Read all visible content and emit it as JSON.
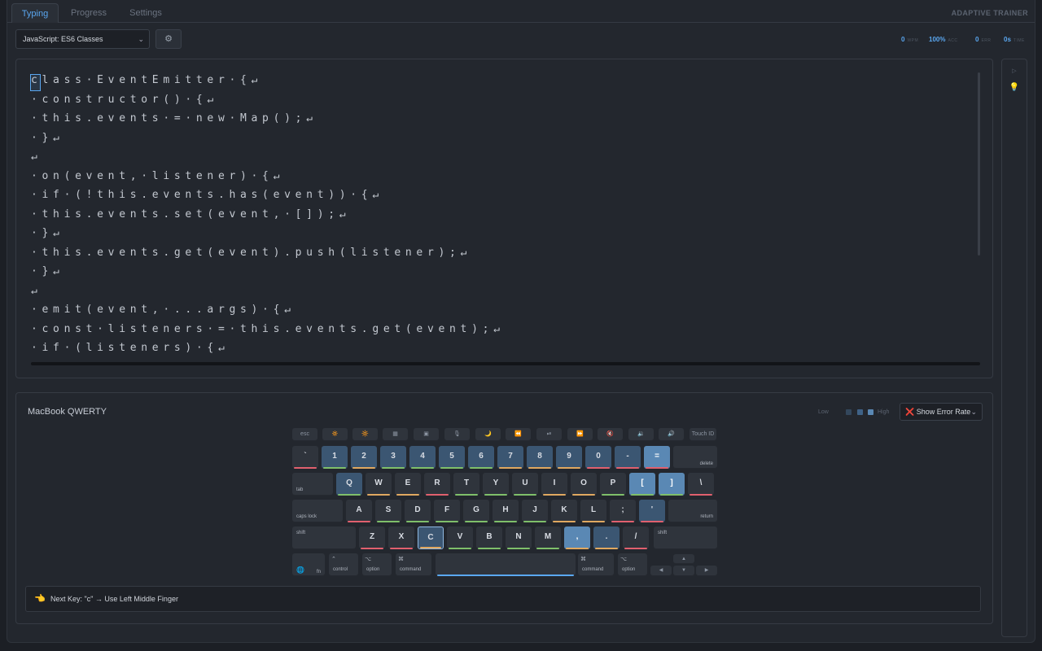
{
  "tabs": [
    {
      "label": "Typing",
      "active": true
    },
    {
      "label": "Progress",
      "active": false
    },
    {
      "label": "Settings",
      "active": false
    }
  ],
  "brand": "ADAPTIVE TRAINER",
  "lesson_select": {
    "value": "JavaScript: ES6 Classes"
  },
  "stats": [
    {
      "value": "0",
      "label": "WPM"
    },
    {
      "value": "100%",
      "label": "ACC"
    },
    {
      "value": "0",
      "label": "ERR"
    },
    {
      "value": "0s",
      "label": "TIME"
    }
  ],
  "code_lines": [
    "class·EventEmitter·{↵",
    "·constructor()·{↵",
    "·this.events·=·new·Map();↵",
    "·}↵",
    "↵",
    "·on(event,·listener)·{↵",
    "·if·(!this.events.has(event))·{↵",
    "·this.events.set(event,·[]);↵",
    "·}↵",
    "·this.events.get(event).push(listener);↵",
    "·}↵",
    "↵",
    "·emit(event,·...args)·{↵",
    "·const·listeners·=·this.events.get(event);↵",
    "·if·(listeners)·{↵"
  ],
  "keyboard": {
    "title": "MacBook QWERTY",
    "legend_low": "Low",
    "legend_high": "High",
    "display_mode": "❌ Show Error Rate",
    "fn_row": [
      "esc",
      "🔅",
      "🔆",
      "▦",
      "▣",
      "🎙",
      "🌙",
      "⏪",
      "⏯",
      "⏩",
      "🔇",
      "🔉",
      "🔊",
      "Touch ID"
    ],
    "num_row": [
      "`",
      "1",
      "2",
      "3",
      "4",
      "5",
      "6",
      "7",
      "8",
      "9",
      "0",
      "-",
      "="
    ],
    "delete": "delete",
    "tab": "tab",
    "q_row": [
      "Q",
      "W",
      "E",
      "R",
      "T",
      "Y",
      "U",
      "I",
      "O",
      "P",
      "[",
      "]",
      "\\"
    ],
    "caps": "caps lock",
    "a_row": [
      "A",
      "S",
      "D",
      "F",
      "G",
      "H",
      "J",
      "K",
      "L",
      ";",
      "'"
    ],
    "return": "return",
    "shift_l": "shift",
    "z_row": [
      "Z",
      "X",
      "C",
      "V",
      "B",
      "N",
      "M",
      ",",
      ".",
      "/"
    ],
    "shift_r": "shift",
    "bottom": {
      "fn": "fn",
      "control": "control",
      "option": "option",
      "command": "command",
      "command_r": "command",
      "option_r": "option"
    },
    "arrows": {
      "up": "▲",
      "left": "◀",
      "down": "▼",
      "right": "▶"
    }
  },
  "hint": "Next Key: \"c\" → Use Left Middle Finger",
  "colors": {
    "accent": "#5aa7f0",
    "bg": "#23272e",
    "err": "#e0606e",
    "ok": "#7fbf6a",
    "warn": "#e0a860"
  }
}
